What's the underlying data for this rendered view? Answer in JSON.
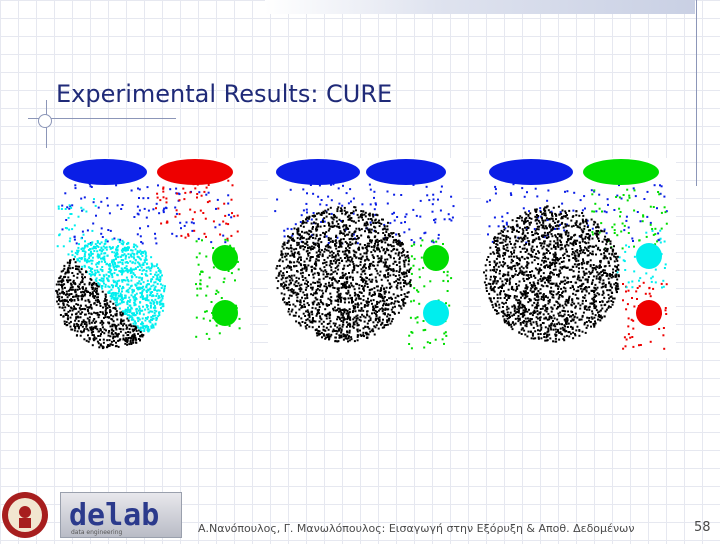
{
  "slide": {
    "title": "Experimental Results: CURE",
    "footer": "Α.Νανόπουλος, Γ. Μανωλόπουλος: Εισαγωγή στην Εξόρυξη & Αποθ. Δεδομένων",
    "page_number": "58"
  },
  "logos": {
    "seal_text": "",
    "lab_text": "delab",
    "lab_subtext": "data engineering"
  },
  "colors": {
    "title": "#1f2a78",
    "blue": "#0a1ee6",
    "red": "#ee0000",
    "green": "#00dd00",
    "cyan": "#00eeee",
    "black": "#000000"
  },
  "panels": [
    {
      "id": "panel-1",
      "ellipses": [
        "blue",
        "red"
      ],
      "circles": [
        "green",
        "green"
      ],
      "big_cluster": "black+cyan"
    },
    {
      "id": "panel-2",
      "ellipses": [
        "blue",
        "blue"
      ],
      "circles": [
        "green",
        "cyan"
      ],
      "big_cluster": "black"
    },
    {
      "id": "panel-3",
      "ellipses": [
        "blue",
        "green"
      ],
      "circles": [
        "cyan",
        "red"
      ],
      "big_cluster": "black"
    }
  ]
}
